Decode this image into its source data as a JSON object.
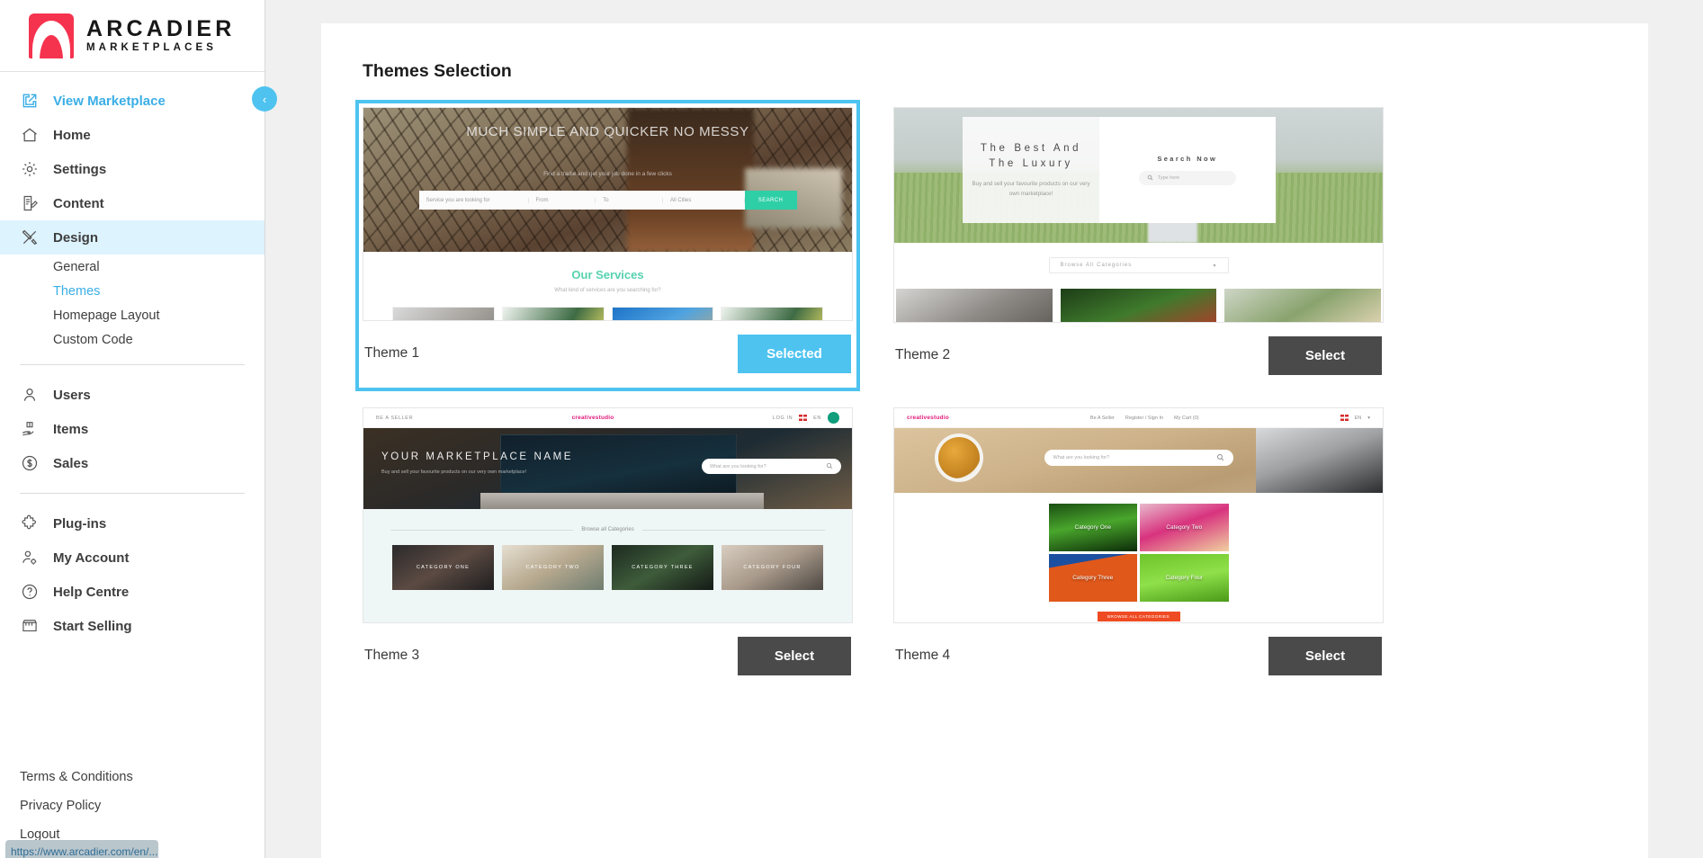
{
  "brand": {
    "name": "ARCADIER",
    "subtitle": "MARKETPLACES"
  },
  "sidebar": {
    "collapse_label": "‹",
    "nav": [
      {
        "label": "View Marketplace",
        "icon": "external-link-icon",
        "accent": true
      },
      {
        "label": "Home",
        "icon": "home-icon"
      },
      {
        "label": "Settings",
        "icon": "gear-icon"
      },
      {
        "label": "Content",
        "icon": "content-edit-icon"
      },
      {
        "label": "Design",
        "icon": "design-tools-icon",
        "active": true
      }
    ],
    "sub_nav": [
      {
        "label": "General"
      },
      {
        "label": "Themes",
        "accent": true
      },
      {
        "label": "Homepage Layout"
      },
      {
        "label": "Custom Code"
      }
    ],
    "nav_group2": [
      {
        "label": "Users",
        "icon": "user-icon"
      },
      {
        "label": "Items",
        "icon": "items-hand-box-icon"
      },
      {
        "label": "Sales",
        "icon": "dollar-circle-icon"
      }
    ],
    "nav_group3": [
      {
        "label": "Plug-ins",
        "icon": "puzzle-icon"
      },
      {
        "label": "My Account",
        "icon": "user-gear-icon"
      },
      {
        "label": "Help Centre",
        "icon": "question-circle-icon"
      },
      {
        "label": "Start Selling",
        "icon": "storefront-icon"
      }
    ],
    "footer_links": [
      {
        "label": "Terms & Conditions"
      },
      {
        "label": "Privacy Policy"
      },
      {
        "label": "Logout"
      }
    ],
    "status_text": "https://www.arcadier.com/en/..."
  },
  "main": {
    "page_title": "Themes Selection",
    "themes": [
      {
        "label": "Theme 1",
        "button": "Selected",
        "selected": true
      },
      {
        "label": "Theme 2",
        "button": "Select",
        "selected": false
      },
      {
        "label": "Theme 3",
        "button": "Select",
        "selected": false
      },
      {
        "label": "Theme 4",
        "button": "Select",
        "selected": false
      }
    ]
  },
  "preview1": {
    "headline": "MUCH SIMPLE AND QUICKER NO MESSY",
    "subheadline": "Find a tradie and get your job done in a few clicks",
    "search_placeholder": "Service you are looking for",
    "search_from": "From",
    "search_to": "To",
    "search_location": "All Cities",
    "search_button": "SEARCH",
    "section_title": "Our Services",
    "section_sub": "What kind of services are you searching for?"
  },
  "preview2": {
    "headline": "The Best And The Luxury",
    "subheadline": "Buy and sell your favourite products on our very own marketplace!",
    "search_title": "Search Now",
    "search_placeholder": "Type here",
    "categories_label": "Browse All Categories"
  },
  "preview3": {
    "be_a_seller": "BE A SELLER",
    "logo": "creativestudio",
    "log_in": "LOG IN",
    "lang": "EN",
    "headline": "YOUR MARKETPLACE NAME",
    "subheadline": "Buy and sell your favourite products on our very own marketplace!",
    "search_placeholder": "What are you looking for?",
    "browse_label": "Browse all Categories",
    "categories": [
      "CATEGORY ONE",
      "CATEGORY TWO",
      "CATEGORY THREE",
      "CATEGORY FOUR"
    ]
  },
  "preview4": {
    "logo": "creativestudio",
    "nav": [
      "Be A Seller",
      "Register / Sign In",
      "My Cart (0)"
    ],
    "lang": "EN",
    "search_placeholder": "What are you looking for?",
    "categories": [
      "Category One",
      "Category Two",
      "Category Three",
      "Category Four"
    ],
    "browse_button": "BROWSE ALL CATEGORIES"
  },
  "colors": {
    "accent": "#4ec3f0",
    "dark_button": "#4a4a4a",
    "brand_red": "#f5334f"
  }
}
